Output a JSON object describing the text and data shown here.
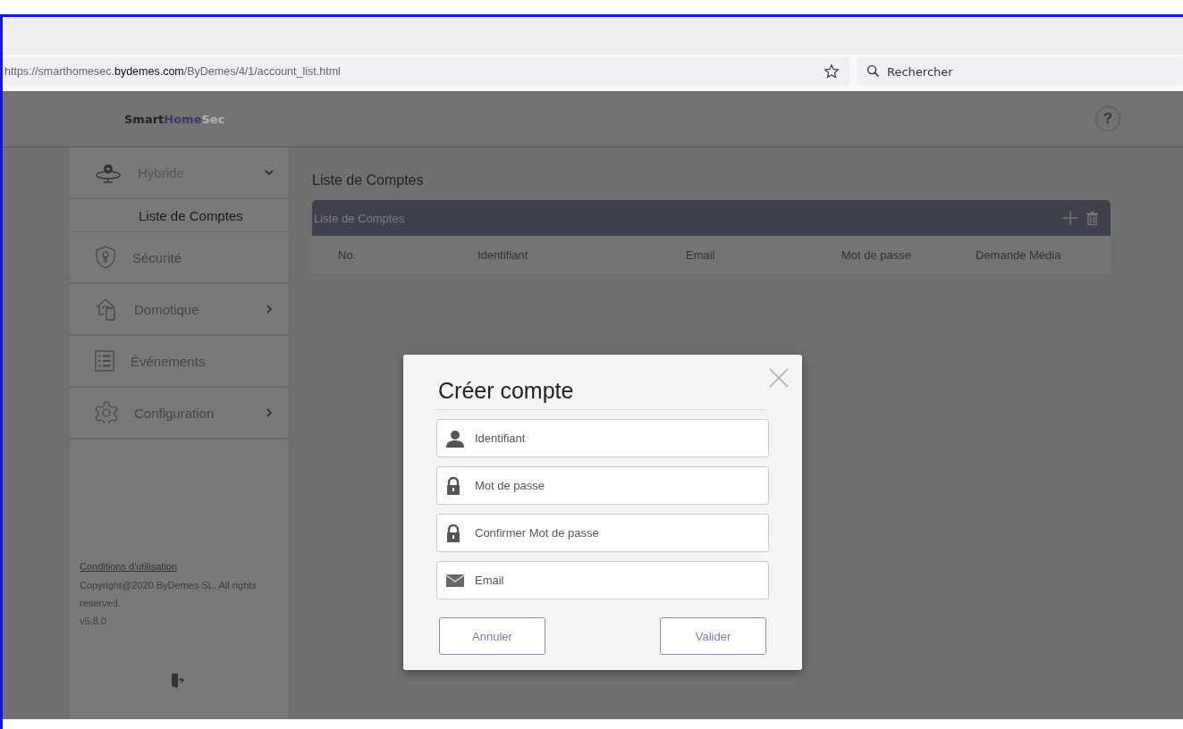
{
  "browser": {
    "url_parts": [
      "https://smarthomesec.",
      "bydemes.com",
      "/ByDemes/4/1/account_list.html"
    ],
    "search": {
      "placeholder": "Rechercher"
    }
  },
  "header": {
    "logo": [
      "Smart",
      "Home",
      "Sec"
    ],
    "help": "?"
  },
  "sidebar": {
    "items": [
      {
        "label": "Hybride",
        "expandable": true,
        "expanded": true,
        "children": [
          {
            "label": "Liste de Comptes",
            "selected": true
          }
        ]
      },
      {
        "label": "Sécurité",
        "expandable": false
      },
      {
        "label": "Domotique",
        "expandable": true,
        "expanded": false
      },
      {
        "label": "Événements",
        "expandable": false
      },
      {
        "label": "Configuration",
        "expandable": true,
        "expanded": false
      }
    ],
    "footer": {
      "link": "Conditions d'utilisation",
      "copyright": "Copyright@2020 ByDemes SL. All rights reserved.",
      "version": "v5.8.0"
    }
  },
  "main": {
    "title": "Liste de Comptes",
    "table": {
      "title": "Liste de Comptes",
      "columns": [
        "No.",
        "Identifiant",
        "Email",
        "Mot de passe",
        "Demande Média"
      ]
    }
  },
  "dialog": {
    "title": "Créer compte",
    "fields": [
      {
        "kind": "user",
        "placeholder": "Identifiant"
      },
      {
        "kind": "lock",
        "placeholder": "Mot de passe"
      },
      {
        "kind": "lock",
        "placeholder": "Confirmer Mot de passe"
      },
      {
        "kind": "mail",
        "placeholder": "Email"
      }
    ],
    "buttons": [
      "Annuler",
      "Valider"
    ]
  }
}
